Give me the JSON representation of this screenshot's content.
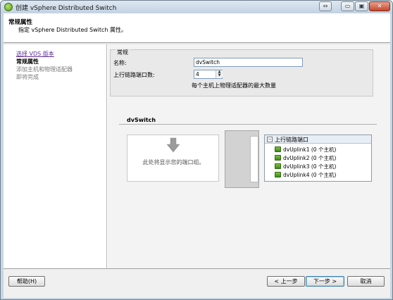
{
  "window": {
    "title": "创建 vSphere Distributed Switch",
    "controls": {
      "restore": "⇔",
      "minimize": "▭",
      "maximize": "▣",
      "close": "✕"
    }
  },
  "header": {
    "title": "常规属性",
    "subtitle": "指定 vSphere Distributed Switch 属性。"
  },
  "nav": {
    "items": [
      {
        "label": "选择 VDS 版本",
        "state": "link"
      },
      {
        "label": "常规属性",
        "state": "current"
      },
      {
        "label": "添加主机和物理适配器",
        "state": "disabled"
      },
      {
        "label": "即将完成",
        "state": "disabled"
      }
    ]
  },
  "general": {
    "legend": "常规",
    "name_label": "名称:",
    "name_value": "dvSwitch",
    "uplink_label": "上行链路端口数:",
    "uplink_value": "4",
    "uplink_hint": "每个主机上物理适配器的最大数量"
  },
  "diagram": {
    "title": "dvSwitch",
    "portgroup_placeholder": "此处将显示您的端口组。",
    "uplinks_title": "上行链路端口",
    "uplinks": [
      "dvUplink1 (0 个主机)",
      "dvUplink2 (0 个主机)",
      "dvUplink3 (0 个主机)",
      "dvUplink4 (0 个主机)"
    ]
  },
  "footer": {
    "help_label": "帮助(H)",
    "back_label": "< 上一步",
    "next_label": "下一步 >",
    "cancel_label": "取消"
  },
  "icons": {
    "app": "vsphere-logo-icon",
    "arrow": "down-arrow-icon",
    "nic": "network-adapter-icon",
    "collapse": "collapse-icon"
  },
  "colors": {
    "link": "#5d2e96",
    "nic_green": "#3e8a16",
    "title_bar": "#c3d2e2"
  }
}
